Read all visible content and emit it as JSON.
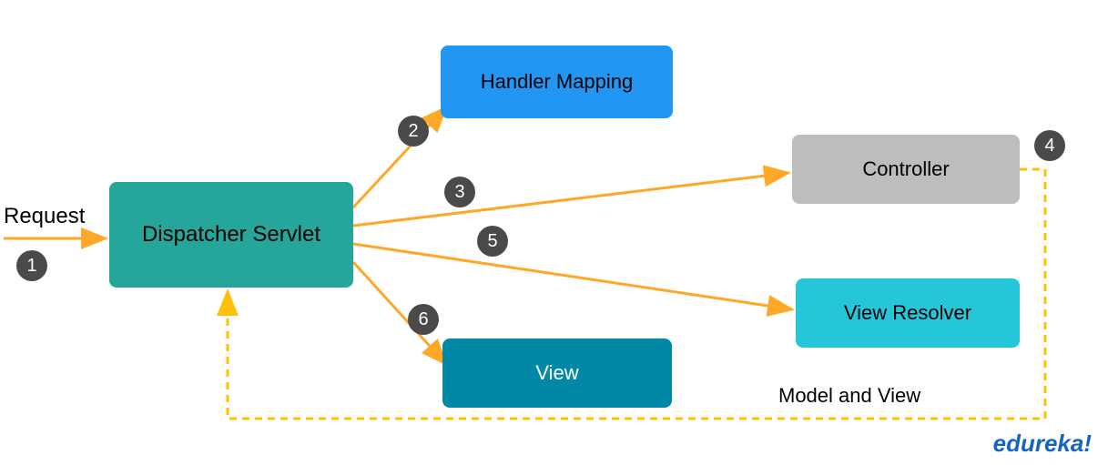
{
  "labels": {
    "request": "Request",
    "model_and_view": "Model and View",
    "brand": "edureka!"
  },
  "boxes": {
    "dispatcher": "Dispatcher Servlet",
    "handler_mapping": "Handler Mapping",
    "controller": "Controller",
    "view_resolver": "View Resolver",
    "view": "View"
  },
  "steps": {
    "s1": "1",
    "s2": "2",
    "s3": "3",
    "s4": "4",
    "s5": "5",
    "s6": "6"
  },
  "colors": {
    "arrow": "#FFA726",
    "dashed": "#FFC107",
    "badge": "#4a4a4a",
    "dispatcher": "#26A69A",
    "handler": "#2196F3",
    "controller": "#BDBDBD",
    "resolver": "#26C6DA",
    "view": "#0288A7",
    "brand": "#1565C0"
  }
}
